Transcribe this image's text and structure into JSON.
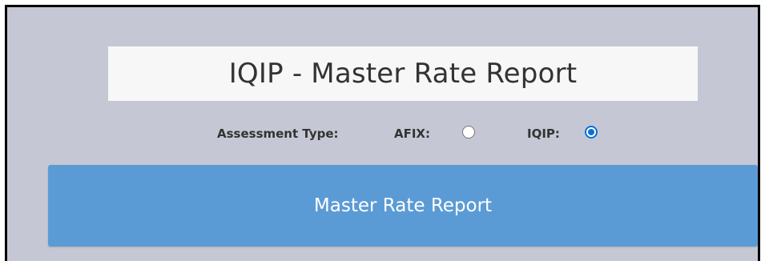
{
  "title": "IQIP - Master Rate Report",
  "assessment": {
    "label": "Assessment Type:",
    "options": [
      {
        "label": "AFIX:",
        "selected": false
      },
      {
        "label": "IQIP:",
        "selected": true
      }
    ]
  },
  "button": {
    "label": "Master Rate Report"
  },
  "colors": {
    "background": "#c5c8d4",
    "title_box": "#f7f7f7",
    "button": "#5b9bd5",
    "radio_selected": "#0a6fd8"
  }
}
